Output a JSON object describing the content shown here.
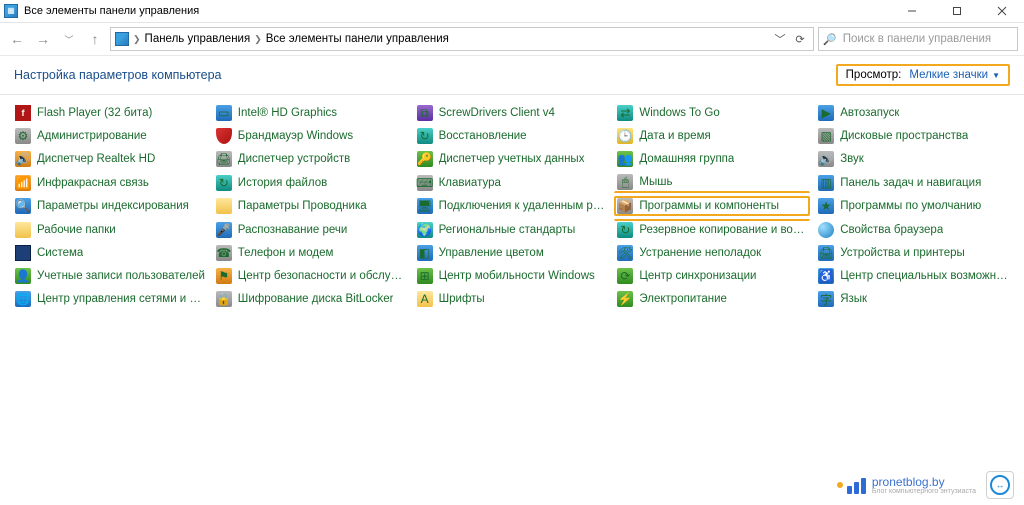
{
  "window": {
    "title": "Все элементы панели управления"
  },
  "nav": {
    "breadcrumb": [
      "Панель управления",
      "Все элементы панели управления"
    ],
    "search_placeholder": "Поиск в панели управления"
  },
  "header": {
    "title": "Настройка параметров компьютера",
    "view_label": "Просмотр:",
    "view_value": "Мелкие значки"
  },
  "highlights": [
    "Программы и компоненты"
  ],
  "partial_highlights": [
    "Мышь",
    "Резервное копирование и восстан..."
  ],
  "items": [
    {
      "label": "Flash Player (32 бита)",
      "icon": "ic-red",
      "glyph": "f"
    },
    {
      "label": "Администрирование",
      "icon": "ic-gray",
      "glyph": "⚙"
    },
    {
      "label": "Диспетчер Realtek HD",
      "icon": "ic-orange",
      "glyph": "🔊"
    },
    {
      "label": "Инфракрасная связь",
      "icon": "ic-orange",
      "glyph": "📶"
    },
    {
      "label": "Параметры индексирования",
      "icon": "ic-blue",
      "glyph": "🔍"
    },
    {
      "label": "Рабочие папки",
      "icon": "ic-folder",
      "glyph": ""
    },
    {
      "label": "Система",
      "icon": "ic-monitor",
      "glyph": ""
    },
    {
      "label": "Учетные записи пользователей",
      "icon": "ic-green",
      "glyph": "👤"
    },
    {
      "label": "Центр управления сетями и общи...",
      "icon": "ic-blue",
      "glyph": "🌐"
    },
    {
      "label": "Intel® HD Graphics",
      "icon": "ic-blue",
      "glyph": "▭"
    },
    {
      "label": "Брандмауэр Windows",
      "icon": "ic-shield",
      "glyph": ""
    },
    {
      "label": "Диспетчер устройств",
      "icon": "ic-gray",
      "glyph": "🖨"
    },
    {
      "label": "История файлов",
      "icon": "ic-teal",
      "glyph": "↻"
    },
    {
      "label": "Параметры Проводника",
      "icon": "ic-folder",
      "glyph": ""
    },
    {
      "label": "Распознавание речи",
      "icon": "ic-blue",
      "glyph": "🎤"
    },
    {
      "label": "Телефон и модем",
      "icon": "ic-gray",
      "glyph": "☎"
    },
    {
      "label": "Центр безопасности и обслужива...",
      "icon": "ic-orange",
      "glyph": "⚑"
    },
    {
      "label": "Шифрование диска BitLocker",
      "icon": "ic-gray",
      "glyph": "🔒"
    },
    {
      "label": "ScrewDrivers Client v4",
      "icon": "ic-purple",
      "glyph": "⧉"
    },
    {
      "label": "Восстановление",
      "icon": "ic-teal",
      "glyph": "↻"
    },
    {
      "label": "Диспетчер учетных данных",
      "icon": "ic-green",
      "glyph": "🔑"
    },
    {
      "label": "Клавиатура",
      "icon": "ic-gray",
      "glyph": "⌨"
    },
    {
      "label": "Подключения к удаленным рабоч...",
      "icon": "ic-blue",
      "glyph": "🖥"
    },
    {
      "label": "Региональные стандарты",
      "icon": "ic-teal",
      "glyph": "🌍"
    },
    {
      "label": "Управление цветом",
      "icon": "ic-blue",
      "glyph": "◧"
    },
    {
      "label": "Центр мобильности Windows",
      "icon": "ic-green",
      "glyph": "⊞"
    },
    {
      "label": "Шрифты",
      "icon": "ic-folder",
      "glyph": "A"
    },
    {
      "label": "Windows To Go",
      "icon": "ic-teal",
      "glyph": "⇄"
    },
    {
      "label": "Дата и время",
      "icon": "ic-yellow",
      "glyph": "🕒"
    },
    {
      "label": "Домашняя группа",
      "icon": "ic-green",
      "glyph": "👥"
    },
    {
      "label": "Мышь",
      "icon": "ic-gray",
      "glyph": "🖱"
    },
    {
      "label": "Программы и компоненты",
      "icon": "ic-gray",
      "glyph": "📦"
    },
    {
      "label": "Резервное копирование и восстан...",
      "icon": "ic-teal",
      "glyph": "↻"
    },
    {
      "label": "Устранение неполадок",
      "icon": "ic-blue",
      "glyph": "🛠"
    },
    {
      "label": "Центр синхронизации",
      "icon": "ic-green",
      "glyph": "⟳"
    },
    {
      "label": "Электропитание",
      "icon": "ic-green",
      "glyph": "⚡"
    },
    {
      "label": "Автозапуск",
      "icon": "ic-blue",
      "glyph": "▶"
    },
    {
      "label": "Дисковые пространства",
      "icon": "ic-gray",
      "glyph": "▧"
    },
    {
      "label": "Звук",
      "icon": "ic-gray",
      "glyph": "🔊"
    },
    {
      "label": "Панель задач и навигация",
      "icon": "ic-blue",
      "glyph": "▥"
    },
    {
      "label": "Программы по умолчанию",
      "icon": "ic-blue",
      "glyph": "★"
    },
    {
      "label": "Свойства браузера",
      "icon": "ic-globe",
      "glyph": ""
    },
    {
      "label": "Устройства и принтеры",
      "icon": "ic-blue",
      "glyph": "🖨"
    },
    {
      "label": "Центр специальных возможностей",
      "icon": "ic-blue",
      "glyph": "♿"
    },
    {
      "label": "Язык",
      "icon": "ic-blue",
      "glyph": "字"
    }
  ],
  "watermark": {
    "text": "pronetblog.by",
    "subtext": "Блог компьютерного энтузиаста"
  }
}
